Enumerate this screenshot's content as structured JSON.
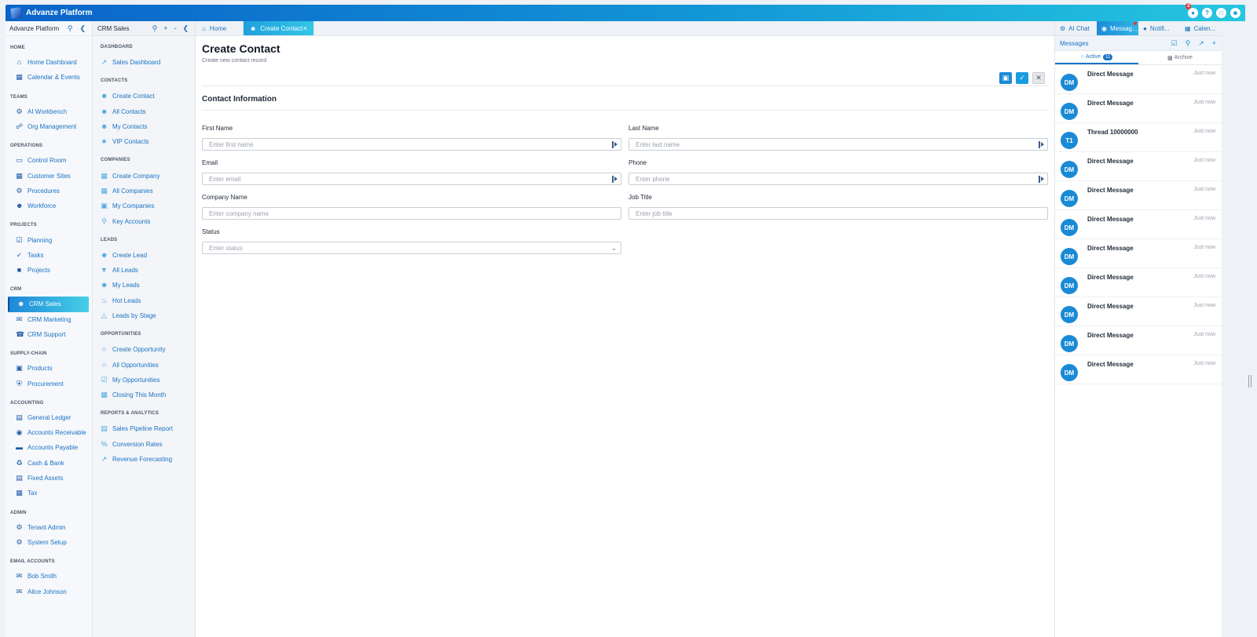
{
  "app": {
    "title": "Advanze Platform",
    "notification_count": "3"
  },
  "nav1": {
    "title": "Advanze Platform",
    "sections": [
      {
        "label": "HOME",
        "items": [
          "Home Dashboard",
          "Calendar & Events"
        ]
      },
      {
        "label": "TEAMS",
        "items": [
          "AI Workbench",
          "Org Management"
        ]
      },
      {
        "label": "OPERATIONS",
        "items": [
          "Control Room",
          "Customer Sites",
          "Procedures",
          "Workforce"
        ]
      },
      {
        "label": "PROJECTS",
        "items": [
          "Planning",
          "Tasks",
          "Projects"
        ]
      },
      {
        "label": "CRM",
        "items": [
          "CRM Sales",
          "CRM Marketing",
          "CRM Support"
        ]
      },
      {
        "label": "SUPPLY-CHAIN",
        "items": [
          "Products",
          "Procurement"
        ]
      },
      {
        "label": "ACCOUNTING",
        "items": [
          "General Ledger",
          "Accounts Receivable",
          "Accounts Payable",
          "Cash & Bank",
          "Fixed Assets",
          "Tax"
        ]
      },
      {
        "label": "ADMIN",
        "items": [
          "Tenant Admin",
          "System Setup"
        ]
      },
      {
        "label": "EMAIL ACCOUNTS",
        "items": [
          "Bob Smith",
          "Alice Johnson"
        ]
      }
    ],
    "active": "CRM Sales"
  },
  "nav2": {
    "title": "CRM Sales",
    "sections": [
      {
        "label": "DASHBOARD",
        "items": [
          "Sales Dashboard"
        ]
      },
      {
        "label": "CONTACTS",
        "items": [
          "Create Contact",
          "All Contacts",
          "My Contacts",
          "VIP Contacts"
        ]
      },
      {
        "label": "COMPANIES",
        "items": [
          "Create Company",
          "All Companies",
          "My Companies",
          "Key Accounts"
        ]
      },
      {
        "label": "LEADS",
        "items": [
          "Create Lead",
          "All Leads",
          "My Leads",
          "Hot Leads",
          "Leads by Stage"
        ]
      },
      {
        "label": "OPPORTUNITIES",
        "items": [
          "Create Opportunity",
          "All Opportunities",
          "My Opportunities",
          "Closing This Month"
        ]
      },
      {
        "label": "REPORTS & ANALYTICS",
        "items": [
          "Sales Pipeline Report",
          "Conversion Rates",
          "Revenue Forecasting"
        ]
      }
    ]
  },
  "tabs": {
    "home": "Home",
    "create_contact": "Create Contact",
    "close": "×"
  },
  "form": {
    "title": "Create Contact",
    "subtitle": "Create new contact record",
    "section": "Contact Information",
    "fields": {
      "first_name": {
        "label": "First Name",
        "placeholder": "Enter first name"
      },
      "last_name": {
        "label": "Last Name",
        "placeholder": "Enter last name"
      },
      "email": {
        "label": "Email",
        "placeholder": "Enter email"
      },
      "phone": {
        "label": "Phone",
        "placeholder": "Enter phone"
      },
      "company": {
        "label": "Company Name",
        "placeholder": "Enter company name"
      },
      "job_title": {
        "label": "Job Title",
        "placeholder": "Enter job title"
      },
      "status": {
        "label": "Status",
        "placeholder": "Enter status"
      }
    }
  },
  "right_panel": {
    "tabs": [
      "AI Chat",
      "Messag...",
      "Notifi...",
      "Calen..."
    ],
    "header": "Messages",
    "subtabs": {
      "active": "Active",
      "active_count": "11",
      "archive": "Archive"
    },
    "messages": [
      {
        "avatar": "DM",
        "title": "Direct Message",
        "time": "Just now"
      },
      {
        "avatar": "DM",
        "title": "Direct Message",
        "time": "Just now"
      },
      {
        "avatar": "T1",
        "title": "Thread 10000000",
        "time": "Just now"
      },
      {
        "avatar": "DM",
        "title": "Direct Message",
        "time": "Just now"
      },
      {
        "avatar": "DM",
        "title": "Direct Message",
        "time": "Just now"
      },
      {
        "avatar": "DM",
        "title": "Direct Message",
        "time": "Just now"
      },
      {
        "avatar": "DM",
        "title": "Direct Message",
        "time": "Just now"
      },
      {
        "avatar": "DM",
        "title": "Direct Message",
        "time": "Just now"
      },
      {
        "avatar": "DM",
        "title": "Direct Message",
        "time": "Just now"
      },
      {
        "avatar": "DM",
        "title": "Direct Message",
        "time": "Just now"
      },
      {
        "avatar": "DM",
        "title": "Direct Message",
        "time": "Just now"
      }
    ]
  },
  "colors": {
    "brand": "#1295d6",
    "accent": "#25c6df",
    "link": "#1a73c4"
  }
}
